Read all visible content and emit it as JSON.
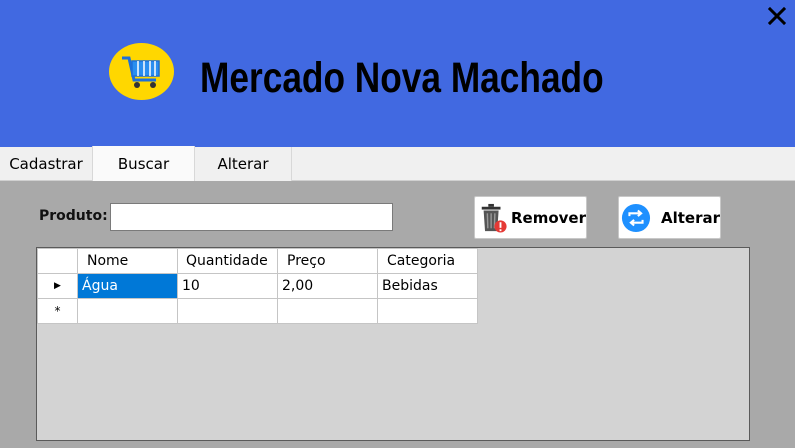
{
  "app": {
    "title": "Mercado Nova Machado"
  },
  "tabs": [
    {
      "label": "Cadastrar"
    },
    {
      "label": "Buscar"
    },
    {
      "label": "Alterar"
    }
  ],
  "search": {
    "label": "Produto:",
    "value": ""
  },
  "buttons": {
    "remover": "Remover",
    "alterar": "Alterar"
  },
  "grid": {
    "columns": [
      "Nome",
      "Quantidade",
      "Preço",
      "Categoria"
    ],
    "rows": [
      [
        "Água",
        "10",
        "2,00",
        "Bebidas"
      ]
    ],
    "new_row_marker": "*",
    "current_row_marker": "▶"
  },
  "colors": {
    "header": "#4169e1",
    "logo_bg": "#ffd700",
    "selection": "#0078d7"
  }
}
